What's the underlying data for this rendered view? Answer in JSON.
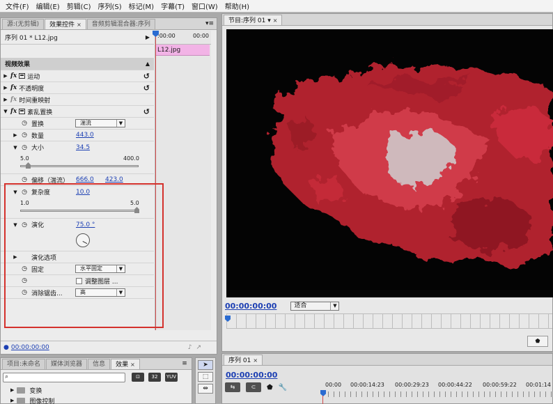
{
  "menu": [
    "文件(F)",
    "编辑(E)",
    "剪辑(C)",
    "序列(S)",
    "标记(M)",
    "字幕(T)",
    "窗口(W)",
    "帮助(H)"
  ],
  "effect_panel": {
    "tabs": [
      "源:(无剪辑)",
      "效果控件",
      "音频剪辑混合器:序列"
    ],
    "seq_label": "序列 01 * L12.jpg",
    "ruler_start": ":00:00",
    "ruler_end": "00:00",
    "clip_name": "L12.jpg",
    "section": "视频效果",
    "effects": [
      "运动",
      "不透明度",
      "时间重映射",
      "紊乱置换"
    ],
    "props": {
      "displacement_label": "置换",
      "displacement_value": "湍流",
      "amount_label": "数量",
      "amount_value": "443.0",
      "size_label": "大小",
      "size_value": "34.5",
      "size_min": "5.0",
      "size_max": "400.0",
      "offset_label": "偏移（湍流）",
      "offset_x": "666.0",
      "offset_y": "423.0",
      "complexity_label": "复杂度",
      "complexity_value": "10.0",
      "complexity_min": "1.0",
      "complexity_max": "5.0",
      "evolution_label": "演化",
      "evolution_value": "75.0 °",
      "evolution_options_label": "演化选项",
      "pinning_label": "固定",
      "pinning_value": "水平固定",
      "resize_layer_label": "调整图层 ...",
      "antialias_label": "消除锯齿...",
      "antialias_value": "高"
    },
    "footer_tc": "00:00:00:00"
  },
  "program": {
    "tab": "节目:序列 01",
    "timecode": "00:00:00:00",
    "fit": "适合"
  },
  "project": {
    "tabs": [
      "项目:未命名",
      "媒体浏览器",
      "信息",
      "效果"
    ],
    "items": [
      "变换",
      "图像控制"
    ]
  },
  "sequence": {
    "tab": "序列 01",
    "timecode": "00:00:00:00",
    "ruler_labels": [
      "00:00",
      "00:00:14:23",
      "00:00:29:23",
      "00:00:44:22",
      "00:00:59:22",
      "00:01:14"
    ]
  }
}
